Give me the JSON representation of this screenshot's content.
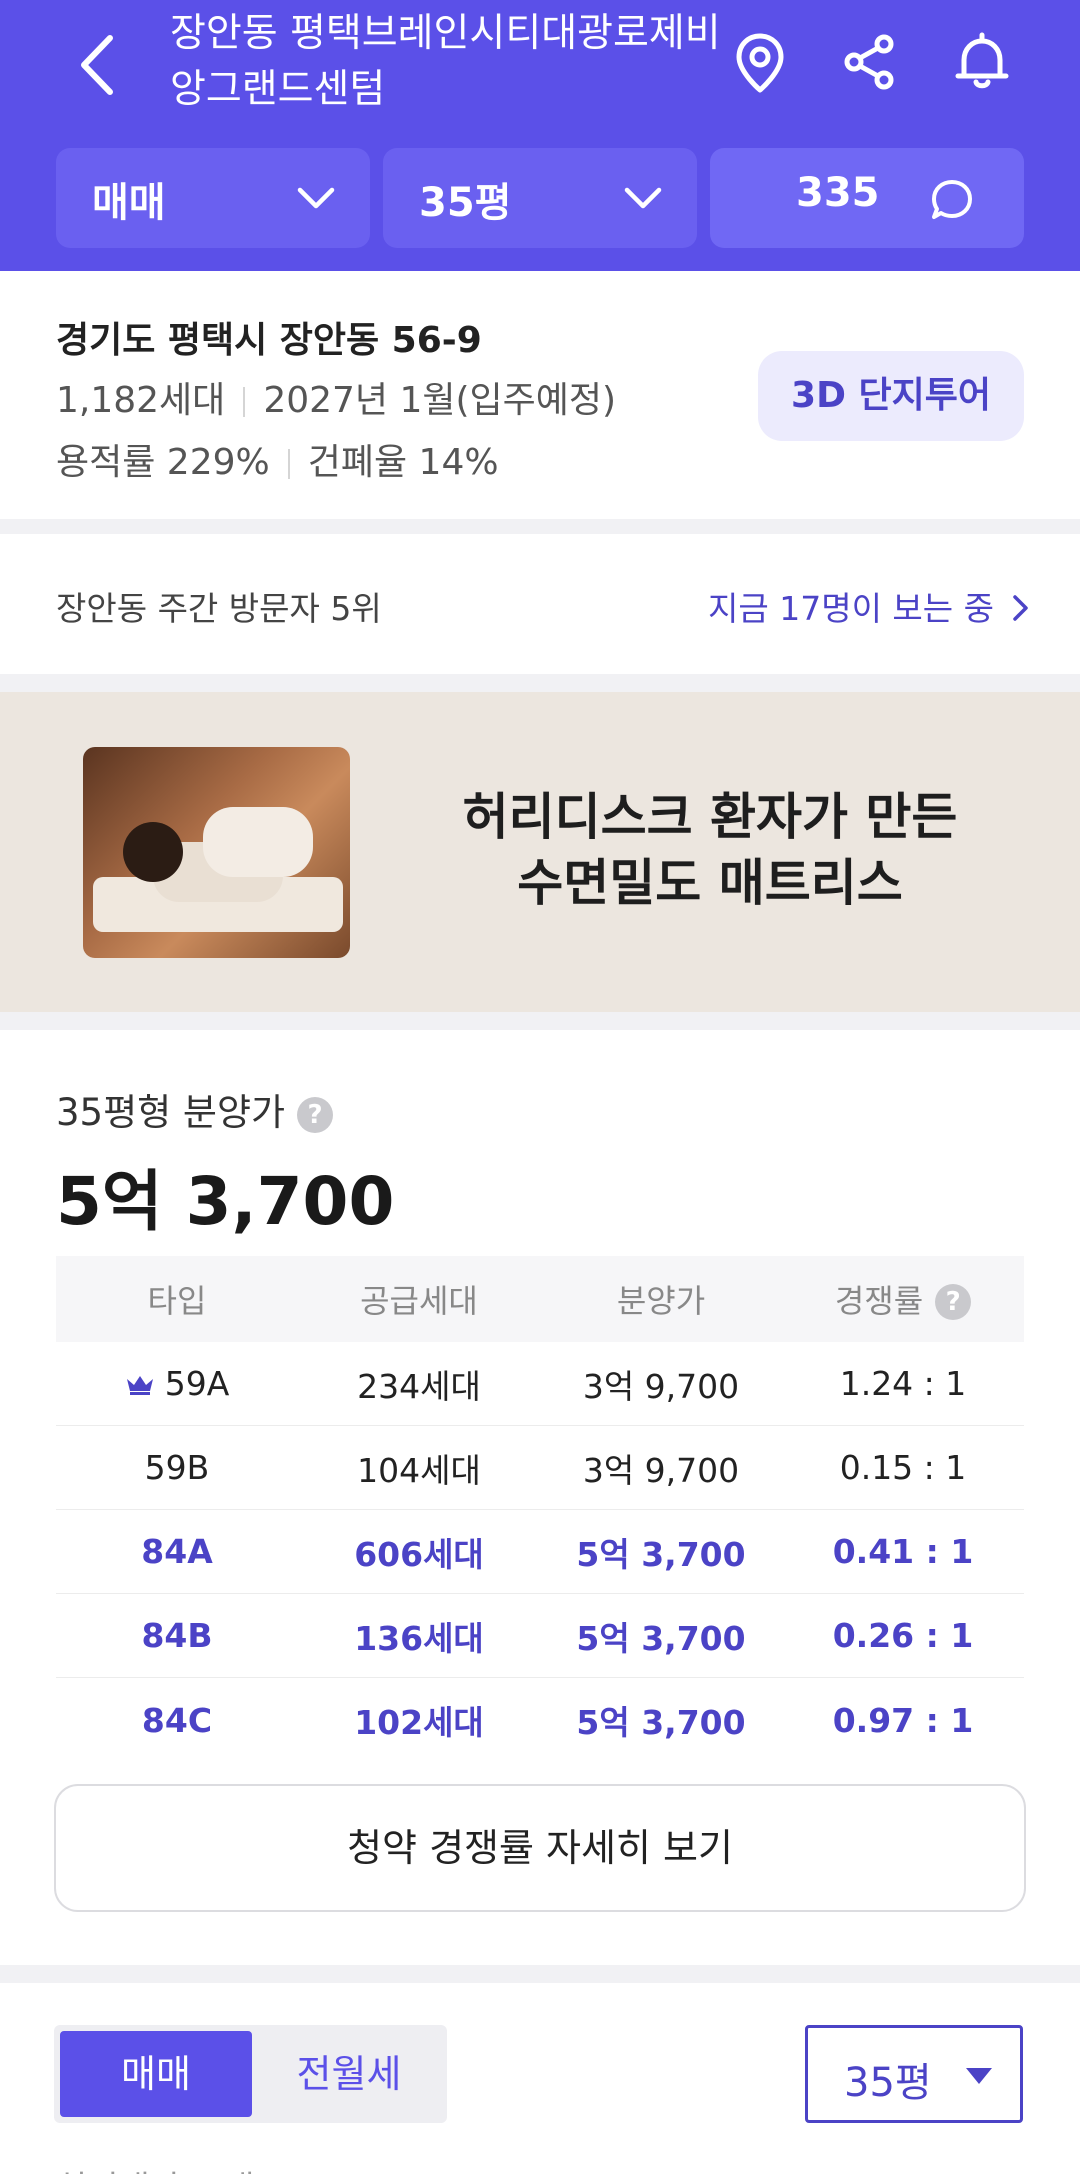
{
  "header": {
    "title": "장안동 평택브레인시티대광로제비앙그랜드센텀",
    "filters": [
      {
        "label": "매매"
      },
      {
        "label": "35평"
      }
    ],
    "comments_count": "335",
    "colors": {
      "brand": "#5b50e8"
    }
  },
  "info": {
    "address": "경기도 평택시 장안동 56-9",
    "households": "1,182세대",
    "move_in": "2027년 1월(입주예정)",
    "floor_area_ratio": "용적률 229%",
    "building_coverage": "건폐율 14%",
    "tour_button": "3D 단지투어"
  },
  "visitors": {
    "rank_text": "장안동 주간 방문자 5위",
    "viewing_text": "지금 17명이 보는 중"
  },
  "ad": {
    "line1": "허리디스크 환자가 만든",
    "line2": "수면밀도 매트리스"
  },
  "price": {
    "label": "35평형 분양가",
    "help": "?",
    "value": "5억 3,700",
    "table": {
      "headers": [
        "타입",
        "공급세대",
        "분양가",
        "경쟁률"
      ],
      "rows": [
        {
          "type": "59A",
          "supply": "234세대",
          "price": "3억 9,700",
          "ratio": "1.24 : 1",
          "highlight": false,
          "crown": true
        },
        {
          "type": "59B",
          "supply": "104세대",
          "price": "3억 9,700",
          "ratio": "0.15 : 1",
          "highlight": false,
          "crown": false
        },
        {
          "type": "84A",
          "supply": "606세대",
          "price": "5억 3,700",
          "ratio": "0.41 : 1",
          "highlight": true,
          "crown": false
        },
        {
          "type": "84B",
          "supply": "136세대",
          "price": "5억 3,700",
          "ratio": "0.26 : 1",
          "highlight": true,
          "crown": false
        },
        {
          "type": "84C",
          "supply": "102세대",
          "price": "5억 3,700",
          "ratio": "0.97 : 1",
          "highlight": true,
          "crown": false
        }
      ]
    },
    "detail_button": "청약 경쟁률 자세히 보기"
  },
  "bottom": {
    "toggle": {
      "on": "매매",
      "off": "전월세"
    },
    "size": "35평",
    "cut_text": "실거래가 그래프"
  }
}
